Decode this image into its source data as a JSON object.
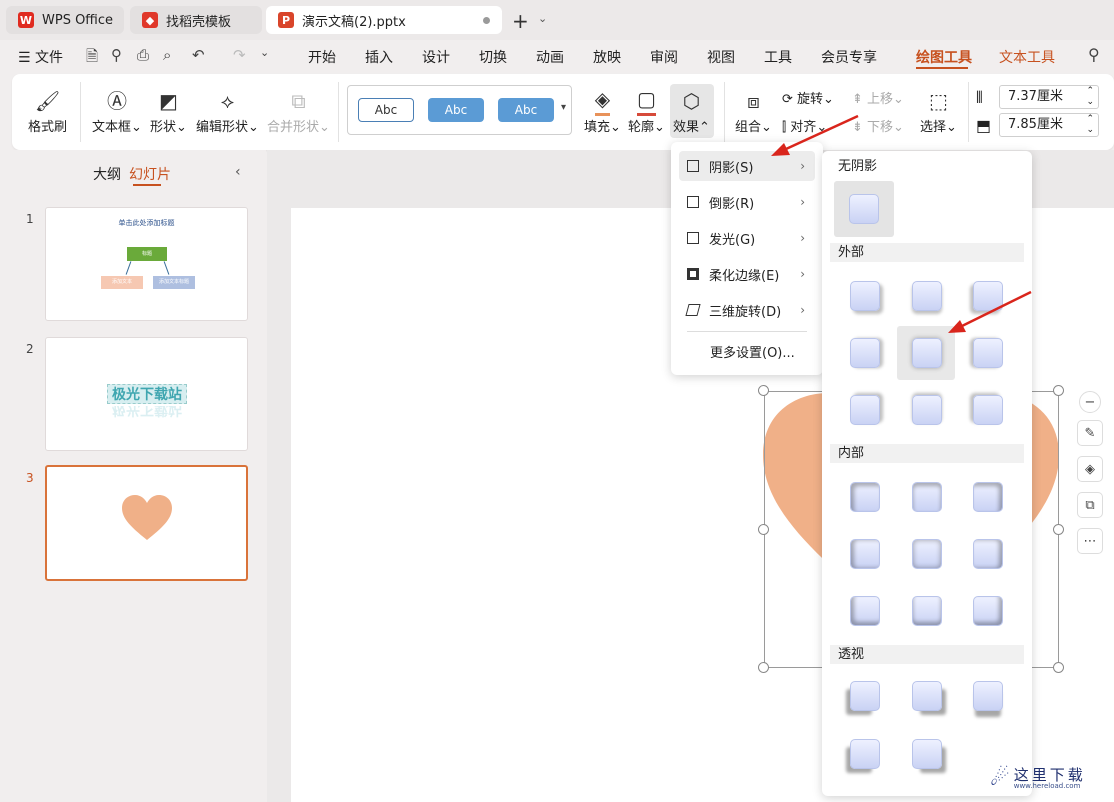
{
  "tabs": [
    {
      "label": "WPS Office"
    },
    {
      "label": "找稻壳模板"
    },
    {
      "label": "演示文稿(2).pptx"
    }
  ],
  "menu": {
    "file": "文件",
    "items": [
      "开始",
      "插入",
      "设计",
      "切换",
      "动画",
      "放映",
      "审阅",
      "视图",
      "工具",
      "会员专享"
    ],
    "drawing_tools": "绘图工具",
    "text_tools": "文本工具"
  },
  "ribbon": {
    "format_painter": "格式刷",
    "textbox": "文本框",
    "shape": "形状",
    "edit_shape": "编辑形状",
    "merge_shape": "合并形状",
    "style_samples": [
      "Abc",
      "Abc",
      "Abc"
    ],
    "fill": "填充",
    "outline": "轮廓",
    "effects": "效果",
    "group": "组合",
    "rotate": "旋转",
    "align": "对齐",
    "move_up": "上移",
    "move_down": "下移",
    "select": "选择",
    "height_value": "7.37厘米",
    "width_value": "7.85厘米"
  },
  "left_panel": {
    "outline_tab": "大纲",
    "slides_tab": "幻灯片",
    "slides": [
      {
        "num": "1",
        "title": "单击此处添加标题",
        "box_top": "标题",
        "box_left": "添加文本",
        "box_right": "添加文本标题"
      },
      {
        "num": "2",
        "text": "极光下载站"
      },
      {
        "num": "3"
      }
    ]
  },
  "effect_menu": {
    "items": [
      "阴影(S)",
      "倒影(R)",
      "发光(G)",
      "柔化边缘(E)",
      "三维旋转(D)"
    ],
    "more": "更多设置(O)..."
  },
  "shadow_panel": {
    "no_shadow": "无阴影",
    "outer": "外部",
    "inner": "内部",
    "perspective": "透视"
  },
  "colors": {
    "accent": "#c7511f",
    "heart": "#f0b088",
    "swatch_blue": "#5b9bd5",
    "arrow": "#d9251c"
  },
  "watermark": "这里下载",
  "watermark_url": "www.hereload.com"
}
